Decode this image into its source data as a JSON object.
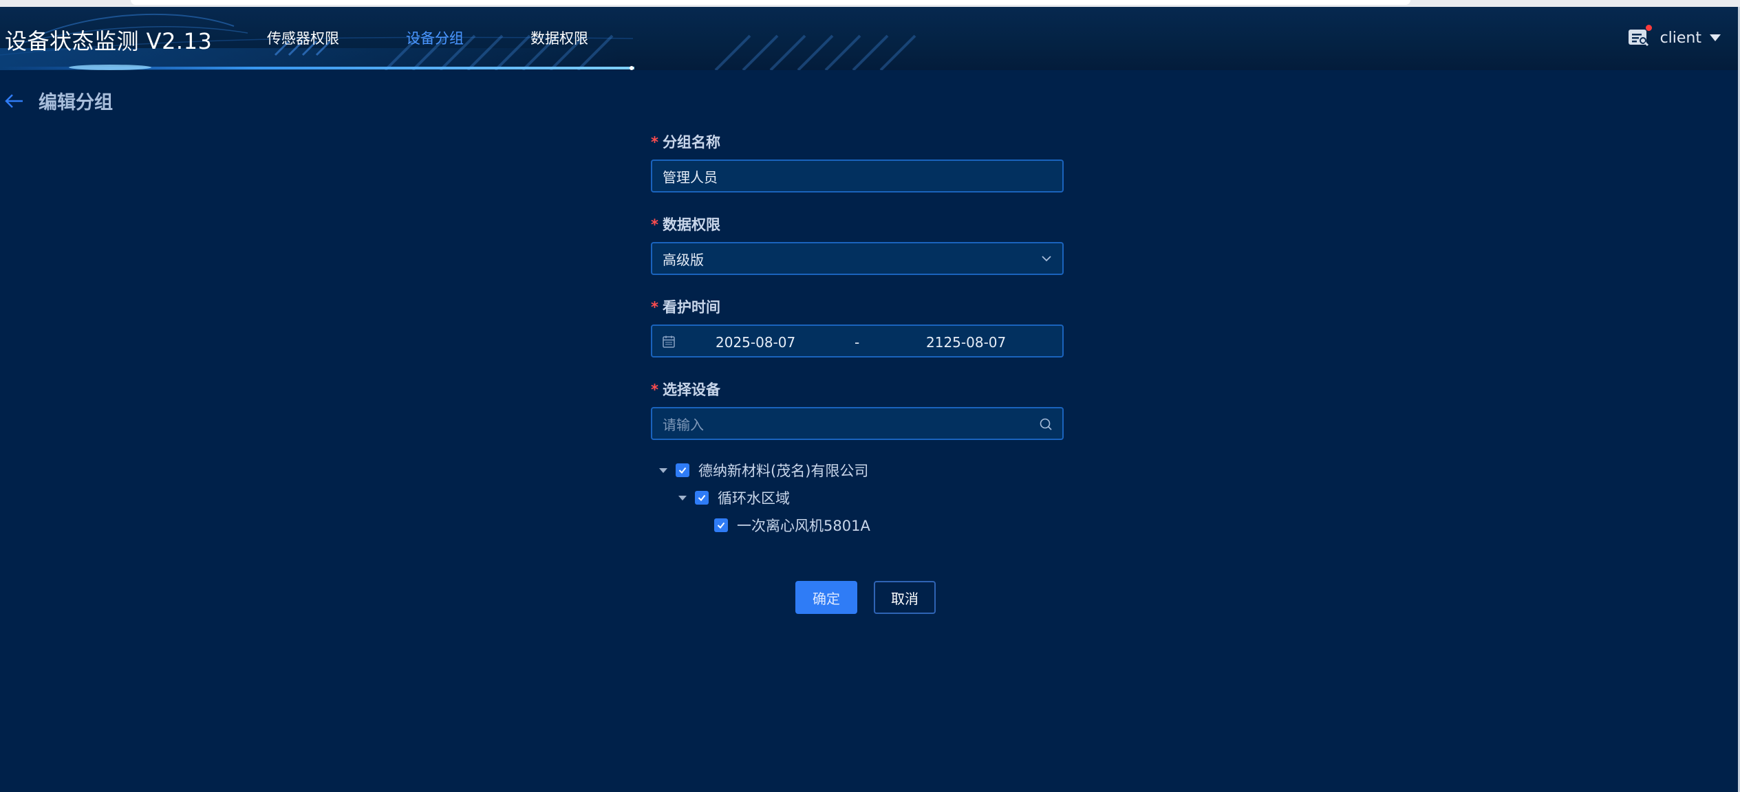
{
  "app": {
    "title": "设备状态监测 V2.13"
  },
  "nav": {
    "items": [
      {
        "label": "传感器权限",
        "active": false
      },
      {
        "label": "设备分组",
        "active": true
      },
      {
        "label": "数据权限",
        "active": false
      }
    ]
  },
  "user": {
    "name": "client",
    "icon": "message-list-icon",
    "has_notification": true
  },
  "page": {
    "title": "编辑分组",
    "back_icon": "arrow-left-icon"
  },
  "form": {
    "required_mark": "*",
    "group_name": {
      "label": "分组名称",
      "value": "管理人员"
    },
    "data_permission": {
      "label": "数据权限",
      "value": "高级版",
      "icon": "chevron-down-icon"
    },
    "care_time": {
      "label": "看护时间",
      "start": "2025-08-07",
      "separator": "-",
      "end": "2125-08-07",
      "icon": "calendar-icon"
    },
    "devices": {
      "label": "选择设备",
      "search_placeholder": "请输入",
      "search_icon": "search-icon",
      "tree": [
        {
          "label": "德纳新材料(茂名)有限公司",
          "checked": true,
          "expanded": true,
          "level": 0
        },
        {
          "label": "循环水区域",
          "checked": true,
          "expanded": true,
          "level": 1
        },
        {
          "label": "一次离心风机5801A",
          "checked": true,
          "expanded": false,
          "level": 2
        }
      ]
    }
  },
  "actions": {
    "confirm": "确定",
    "cancel": "取消"
  },
  "colors": {
    "background": "#00214a",
    "accent": "#2f7cf6",
    "active_nav": "#4a96ff",
    "required": "#ff4d4f",
    "input_border": "#1a63bd"
  }
}
